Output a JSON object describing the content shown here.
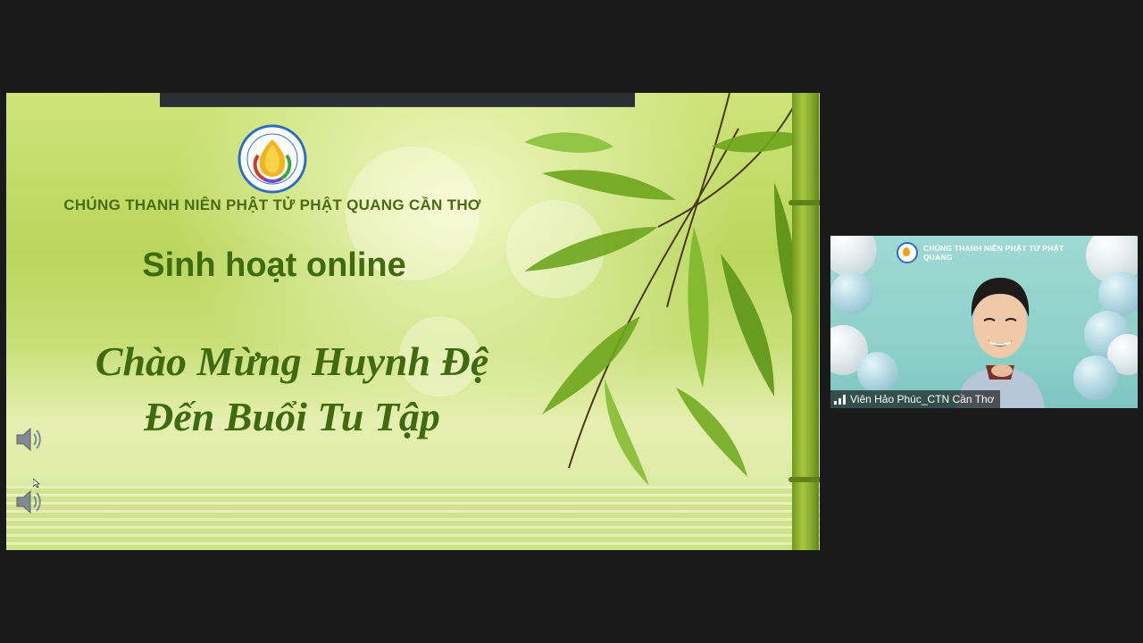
{
  "screen_share": {
    "org_title": "CHÚNG THANH NIÊN PHẬT TỬ PHẬT QUANG CẦN THƠ",
    "heading": "Sinh hoạt online",
    "welcome_line1": "Chào Mừng Huynh Đệ",
    "welcome_line2": "Đến Buổi Tu Tập",
    "logo_icon": "buddhist-youth-logo-icon",
    "audio_icon": "speaker-icon",
    "colors": {
      "text_green": "#3f6a10",
      "background_green": "#c8df78"
    }
  },
  "participant_video": {
    "banner_text": "CHÚNG THANH NIÊN PHẬT TỬ PHẬT QUANG",
    "name": "Viên Hảo Phúc_CTN Cần Thơ",
    "signal_icon": "signal-bars-icon"
  }
}
